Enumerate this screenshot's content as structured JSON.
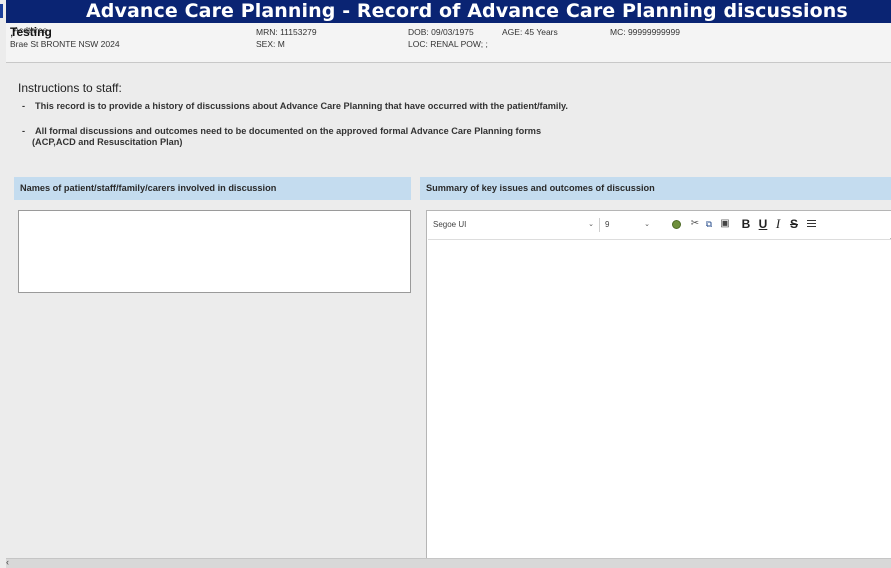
{
  "window": {
    "title": "Advance Care Planning - Record of Advance Care Planning discussions"
  },
  "patient": {
    "last_name": "Testing",
    "first_name": "Acdthree",
    "address": "Brae St BRONTE NSW 2024",
    "mrn": "MRN: 11153279",
    "sex": "SEX: M",
    "dob": "DOB: 09/03/1975",
    "location": "LOC: RENAL POW; ;",
    "age": "AGE: 45 Years",
    "mc": "MC: 99999999999"
  },
  "instructions": {
    "title": "Instructions to staff:",
    "item1": "This record is to provide a history of discussions about Advance Care Planning that have occurred with the patient/family.",
    "item2_line1": "All formal discussions and outcomes need to be documented on the approved formal Advance Care Planning forms",
    "item2_line2": "(ACP,ACD and Resuscitation Plan)",
    "bullet": "-"
  },
  "sections": {
    "names_header": "Names of patient/staff/family/carers involved in discussion",
    "summary_header": "Summary of key issues and outcomes of discussion"
  },
  "editor": {
    "font": "Segoe UI",
    "size": "9",
    "bold_label": "B",
    "underline_label": "U",
    "italic_label": "I",
    "strike_label": "S",
    "dropdown_chevron": "⌄",
    "names_value": "",
    "summary_value": ""
  },
  "icons": {
    "paint": "color-fill-icon",
    "cut": "scissors-icon",
    "copy": "copy-icon",
    "paste": "paste-icon",
    "align": "align-left-icon",
    "scroll_left": "arrow-left-icon"
  },
  "colors": {
    "title_bar": "#0a2473",
    "section_header": "#c4dcef"
  }
}
